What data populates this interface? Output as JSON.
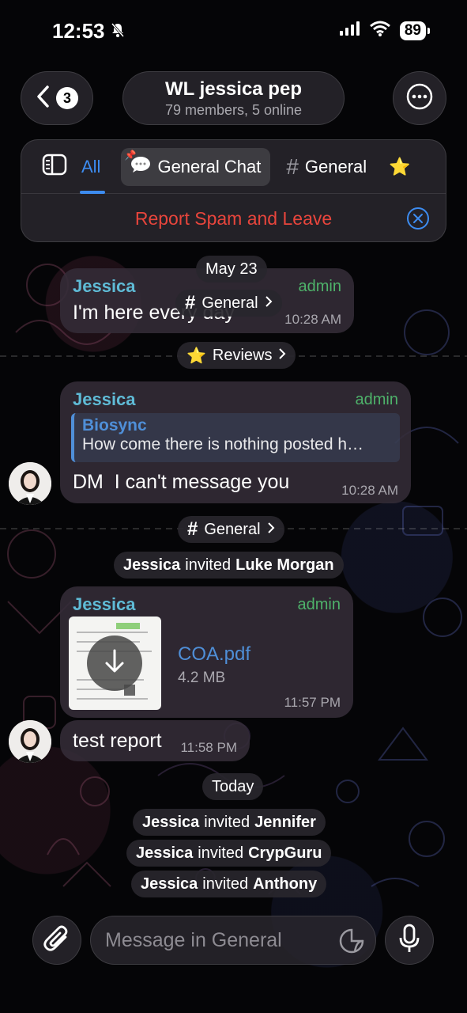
{
  "status_bar": {
    "time": "12:53",
    "battery": "89"
  },
  "header": {
    "back_count": "3",
    "title": "WL jessica pep",
    "subtitle": "79 members, 5 online"
  },
  "topics": {
    "tabs": [
      {
        "label": "All"
      },
      {
        "label": "General Chat"
      },
      {
        "label": "General"
      }
    ],
    "report_label": "Report Spam and Leave"
  },
  "chat": {
    "date_chip_1": "May 23",
    "msg1": {
      "sender": "Jessica",
      "badge": "admin",
      "text": "I'm here every day",
      "time": "10:28 AM"
    },
    "topic_chip_general_1": "General",
    "topic_chip_reviews": "Reviews",
    "msg2": {
      "sender": "Jessica",
      "badge": "admin",
      "reply_name": "Biosync",
      "reply_text": "How come there is nothing posted h…",
      "text": "DM  I can't message you",
      "time": "10:28 AM"
    },
    "topic_chip_general_2": "General",
    "service1": {
      "actor": "Jessica",
      "verb": "invited",
      "target": "Luke Morgan"
    },
    "msg3": {
      "sender": "Jessica",
      "badge": "admin",
      "file_name": "COA.pdf",
      "file_size": "4.2 MB",
      "time": "11:57 PM"
    },
    "msg4": {
      "text": "test report",
      "time": "11:58 PM"
    },
    "date_chip_2": "Today",
    "service2": {
      "actor": "Jessica",
      "verb": "invited",
      "target": "Jennifer"
    },
    "service3": {
      "actor": "Jessica",
      "verb": "invited",
      "target": "CrypGuru"
    },
    "service4": {
      "actor": "Jessica",
      "verb": "invited",
      "target": "Anthony"
    }
  },
  "composer": {
    "placeholder": "Message in General"
  },
  "colors": {
    "accent": "#3d8cf0",
    "danger": "#e8453c",
    "sender": "#5fbbd6",
    "admin": "#4eb26a"
  }
}
